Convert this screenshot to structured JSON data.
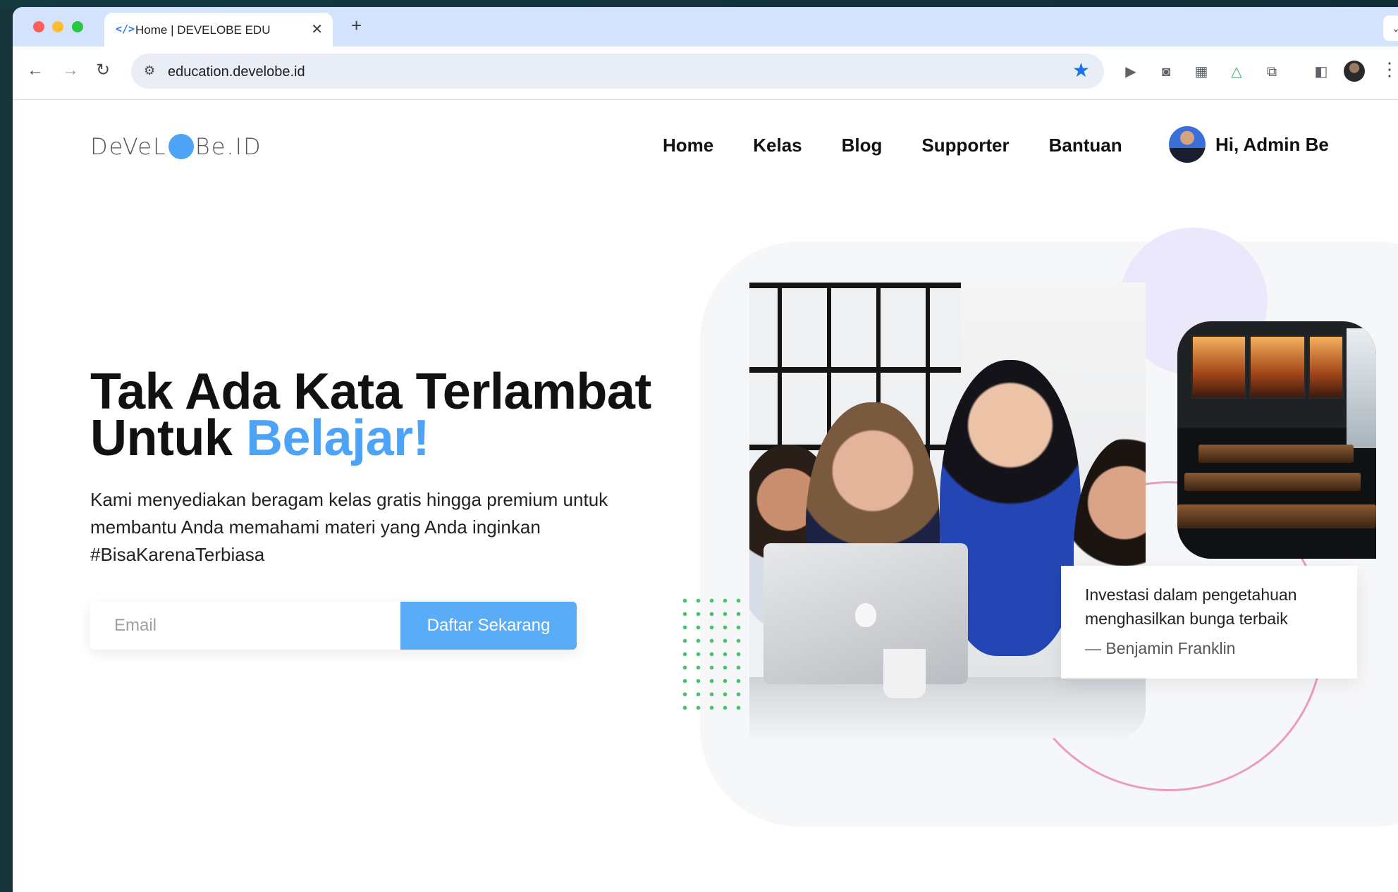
{
  "browser": {
    "tab_title": "Home | DEVELOBE EDU",
    "tab_icon": "</>",
    "close_glyph": "✕",
    "new_tab_glyph": "+",
    "url": "education.develobe.id",
    "accent": "#1a73e8"
  },
  "site": {
    "logo": {
      "left": "DeVeL",
      "right": "Be.ID"
    },
    "nav": [
      "Home",
      "Kelas",
      "Blog",
      "Supporter",
      "Bantuan"
    ],
    "user_greeting": "Hi, Admin Be"
  },
  "hero": {
    "headline_line1": "Tak Ada Kata Terlambat",
    "headline_line2_prefix": "Untuk ",
    "headline_accent": "Belajar!",
    "accent_color": "#4da3f5",
    "subtext": "Kami menyediakan beragam kelas gratis hingga premium untuk membantu Anda memahami materi yang Anda inginkan #BisaKarenaTerbiasa",
    "email_placeholder": "Email",
    "cta_label": "Daftar Sekarang"
  },
  "quote": {
    "text": "Investasi dalam pengetahuan menghasilkan bunga terbaik",
    "author": "— Benjamin Franklin"
  }
}
